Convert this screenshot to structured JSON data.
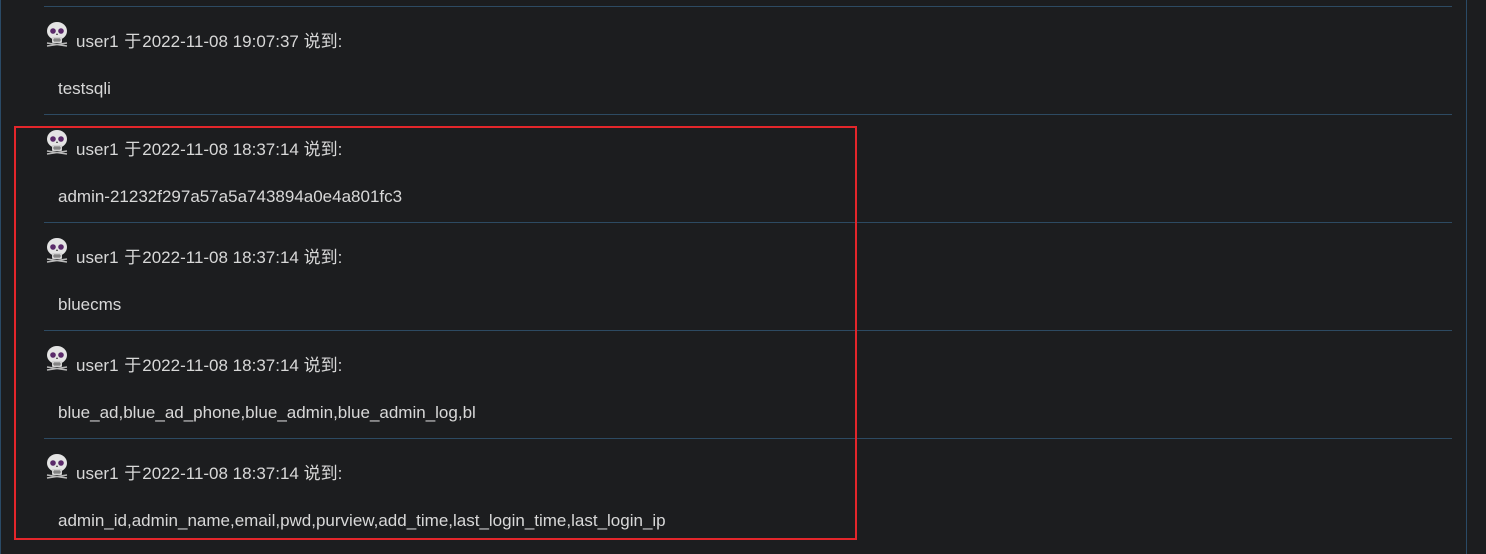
{
  "comments": [
    {
      "user": "user1",
      "prefix": "于",
      "datetime": "2022-11-08 19:07:37",
      "suffix": "说到:",
      "text": "testsqli",
      "avatar_icon": "skull-avatar-icon"
    },
    {
      "user": "user1",
      "prefix": "于",
      "datetime": "2022-11-08 18:37:14",
      "suffix": "说到:",
      "text": "admin-21232f297a57a5a743894a0e4a801fc3",
      "avatar_icon": "skull-avatar-icon"
    },
    {
      "user": "user1",
      "prefix": "于",
      "datetime": "2022-11-08 18:37:14",
      "suffix": "说到:",
      "text": "bluecms",
      "avatar_icon": "skull-avatar-icon"
    },
    {
      "user": "user1",
      "prefix": "于",
      "datetime": "2022-11-08 18:37:14",
      "suffix": "说到:",
      "text": "blue_ad,blue_ad_phone,blue_admin,blue_admin_log,bl",
      "avatar_icon": "skull-avatar-icon"
    },
    {
      "user": "user1",
      "prefix": "于",
      "datetime": "2022-11-08 18:37:14",
      "suffix": "说到:",
      "text": "admin_id,admin_name,email,pwd,purview,add_time,last_login_time,last_login_ip",
      "avatar_icon": "skull-avatar-icon"
    }
  ],
  "colors": {
    "background": "#1c1d1f",
    "divider": "#2d4a62",
    "text": "#d8d8d8",
    "highlight_box": "#e3262b"
  }
}
